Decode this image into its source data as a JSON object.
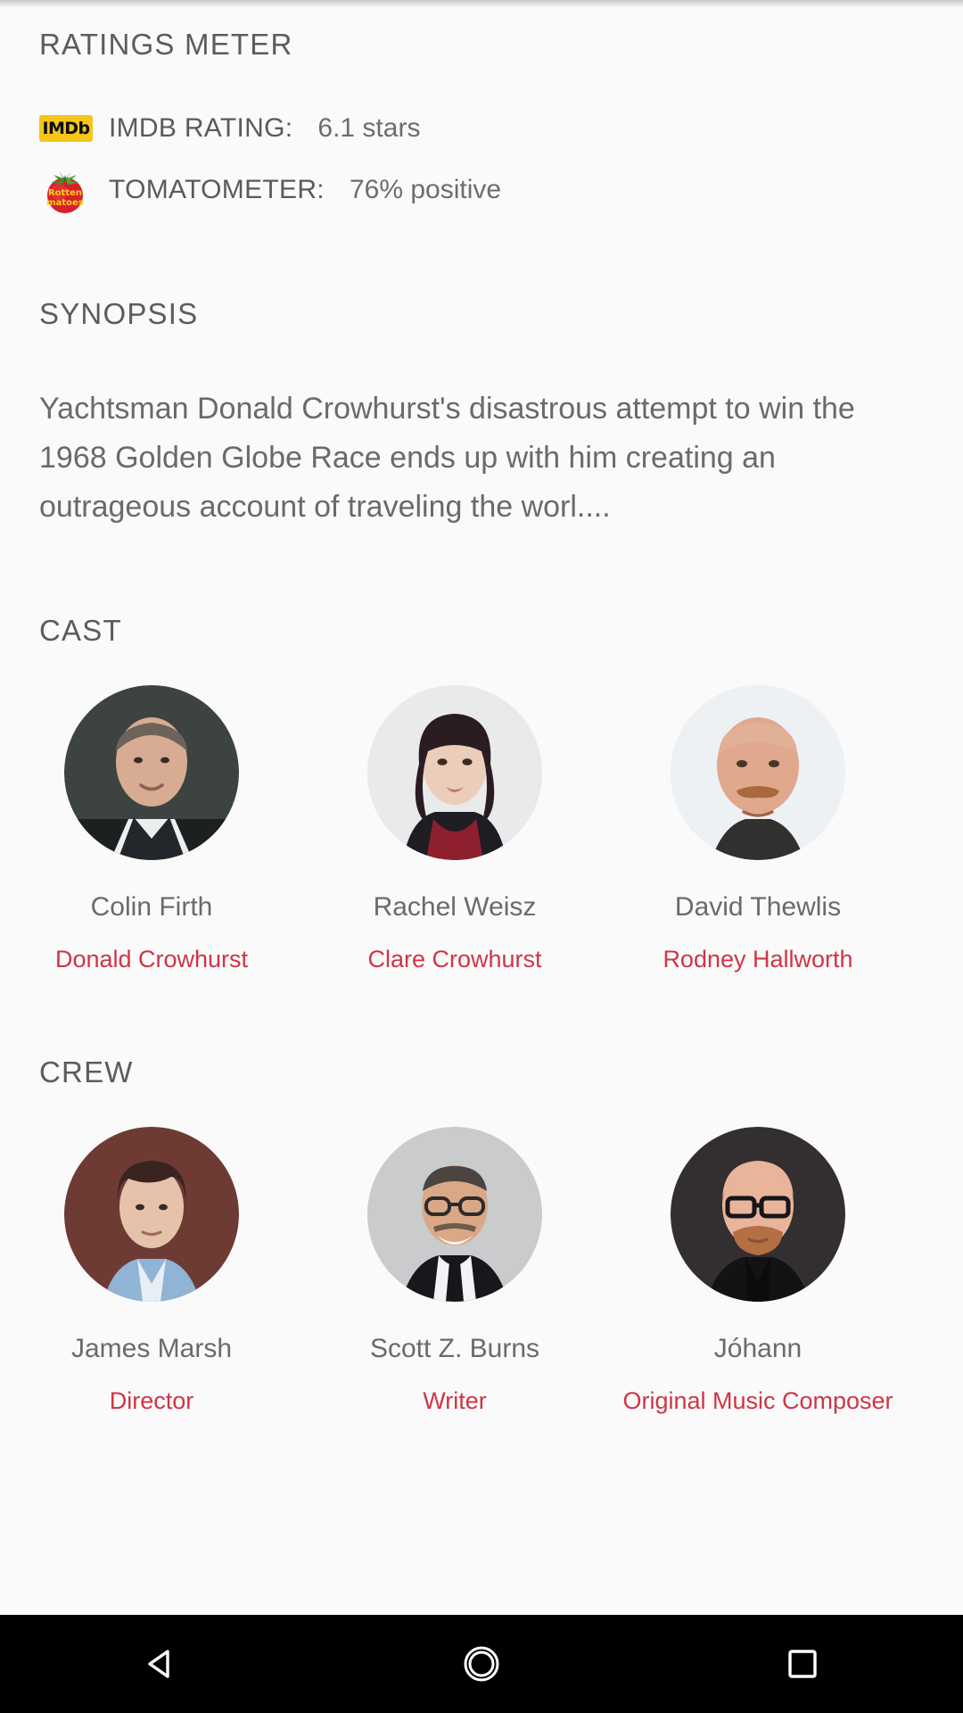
{
  "ratings": {
    "section_title": "RATINGS METER",
    "rows": [
      {
        "icon": "imdb-logo-icon",
        "icon_text": "IMDb",
        "label": "IMDB RATING:",
        "value": "6.1 stars"
      },
      {
        "icon": "rotten-tomatoes-logo-icon",
        "icon_text": "Rotten Tomatoes",
        "label": "TOMATOMETER:",
        "value": "76% positive"
      }
    ]
  },
  "synopsis": {
    "section_title": "SYNOPSIS",
    "text": "Yachtsman Donald Crowhurst's disastrous attempt to win the 1968 Golden Globe Race ends up with him creating an outrageous account of traveling the worl...."
  },
  "cast": {
    "section_title": "CAST",
    "people": [
      {
        "name": "Colin Firth",
        "role": "Donald Crowhurst"
      },
      {
        "name": "Rachel Weisz",
        "role": "Clare Crowhurst"
      },
      {
        "name": "David Thewlis",
        "role": "Rodney Hallworth"
      }
    ]
  },
  "crew": {
    "section_title": "CREW",
    "people": [
      {
        "name": "James Marsh",
        "role": "Director"
      },
      {
        "name": "Scott Z. Burns",
        "role": "Writer"
      },
      {
        "name": "Jóhann",
        "role": "Original Music Composer"
      }
    ]
  },
  "navbar": {
    "buttons": [
      {
        "name": "back-button",
        "icon": "back-triangle-icon"
      },
      {
        "name": "home-button",
        "icon": "home-circle-icon"
      },
      {
        "name": "recents-button",
        "icon": "square-icon"
      }
    ]
  },
  "colors": {
    "background": "#fafafa",
    "heading": "#5c5c5c",
    "body_text": "#6a6a6a",
    "role_accent": "#cf3546",
    "imdb_yellow": "#f5c518",
    "tomato_red": "#d8202a",
    "navbar": "#000000"
  }
}
